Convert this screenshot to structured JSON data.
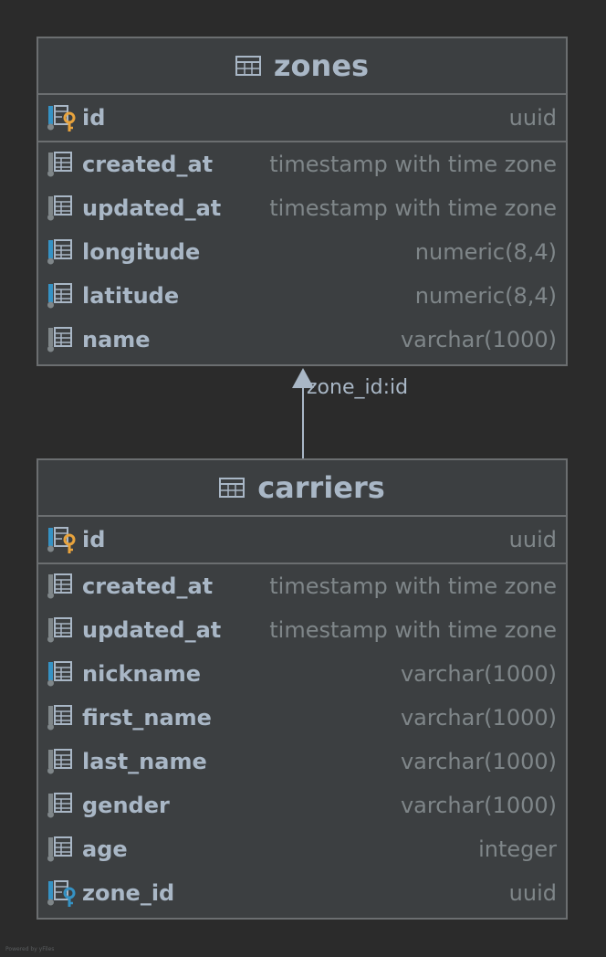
{
  "tables": [
    {
      "name": "zones",
      "primary": [
        {
          "name": "id",
          "type": "uuid",
          "kind": "primary-key"
        }
      ],
      "columns": [
        {
          "name": "created_at",
          "type": "timestamp with time zone",
          "kind": "column"
        },
        {
          "name": "updated_at",
          "type": "timestamp with time zone",
          "kind": "column"
        },
        {
          "name": "longitude",
          "type": "numeric(8,4)",
          "kind": "indexed-column"
        },
        {
          "name": "latitude",
          "type": "numeric(8,4)",
          "kind": "indexed-column"
        },
        {
          "name": "name",
          "type": "varchar(1000)",
          "kind": "column"
        }
      ]
    },
    {
      "name": "carriers",
      "primary": [
        {
          "name": "id",
          "type": "uuid",
          "kind": "primary-key"
        }
      ],
      "columns": [
        {
          "name": "created_at",
          "type": "timestamp with time zone",
          "kind": "column"
        },
        {
          "name": "updated_at",
          "type": "timestamp with time zone",
          "kind": "column"
        },
        {
          "name": "nickname",
          "type": "varchar(1000)",
          "kind": "indexed-column"
        },
        {
          "name": "first_name",
          "type": "varchar(1000)",
          "kind": "column"
        },
        {
          "name": "last_name",
          "type": "varchar(1000)",
          "kind": "column"
        },
        {
          "name": "gender",
          "type": "varchar(1000)",
          "kind": "column"
        },
        {
          "name": "age",
          "type": "integer",
          "kind": "column"
        },
        {
          "name": "zone_id",
          "type": "uuid",
          "kind": "foreign-key"
        }
      ]
    }
  ],
  "relationship": {
    "label": "zone_id:id",
    "from": "carriers",
    "to": "zones"
  },
  "watermark": "Powered by yFiles",
  "colors": {
    "background": "#2b2b2b",
    "table_fill": "#3c3f41",
    "border": "#6b6e70",
    "text": "#a9b7c6",
    "type_text": "#7f8689",
    "index_marker": "#3592c4",
    "primary_key": "#e8a33d",
    "foreign_key": "#3592c4"
  }
}
